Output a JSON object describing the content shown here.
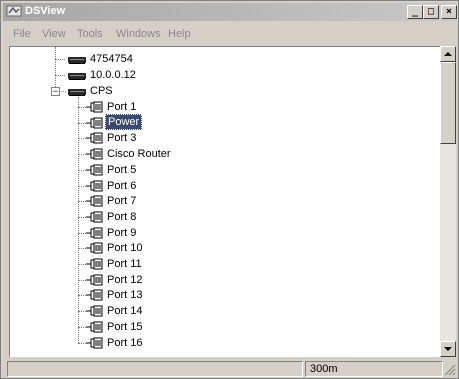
{
  "window": {
    "title": "DSView"
  },
  "menu": {
    "items": [
      "File",
      "View",
      "Tools",
      "Windows",
      "Help"
    ]
  },
  "tree": {
    "servers": [
      "4754754",
      "10.0.0.12"
    ],
    "group": {
      "label": "CPS",
      "expander": "−"
    },
    "ports": [
      "Port 1",
      "Power",
      "Port 3",
      "Cisco Router",
      "Port 5",
      "Port 6",
      "Port 7",
      "Port 8",
      "Port 9",
      "Port 10",
      "Port 11",
      "Port 12",
      "Port 13",
      "Port 14",
      "Port 15",
      "Port 16"
    ],
    "selected_index": 1
  },
  "status": {
    "timer": "300m"
  },
  "icons": {
    "server": "server-icon",
    "port": "serial-port-icon"
  },
  "colors": {
    "selection": "#3a4a6e"
  }
}
